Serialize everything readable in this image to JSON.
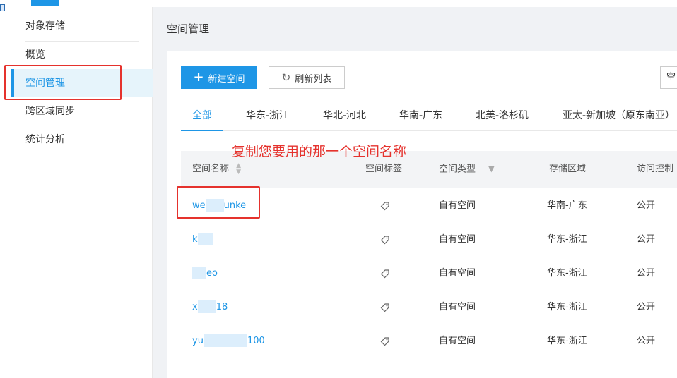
{
  "sidebar": {
    "section_title": "对象存储",
    "items": [
      {
        "label": "概览"
      },
      {
        "label": "空间管理"
      },
      {
        "label": "跨区域同步"
      },
      {
        "label": "统计分析"
      }
    ]
  },
  "main": {
    "title": "空间管理",
    "toolbar": {
      "new_bucket_label": "新建空间",
      "refresh_label": "刷新列表",
      "cut_off_button_label": "空"
    },
    "tabs": [
      {
        "label": "全部"
      },
      {
        "label": "华东-浙江"
      },
      {
        "label": "华北-河北"
      },
      {
        "label": "华南-广东"
      },
      {
        "label": "北美-洛杉矶"
      },
      {
        "label": "亚太-新加坡（原东南亚）"
      }
    ],
    "annotation": "复制您要用的那一个空间名称",
    "table": {
      "columns": [
        "空间名称",
        "空间标签",
        "空间类型",
        "存储区域",
        "访问控制"
      ],
      "rows": [
        {
          "name_start": "we",
          "name_end": "unke",
          "type": "自有空间",
          "region": "华南-广东",
          "access": "公开"
        },
        {
          "name_start": "k",
          "name_end": "",
          "type": "自有空间",
          "region": "华东-浙江",
          "access": "公开"
        },
        {
          "name_start": "",
          "name_end": "eo",
          "type": "自有空间",
          "region": "华东-浙江",
          "access": "公开"
        },
        {
          "name_start": "x",
          "name_end": "18",
          "type": "自有空间",
          "region": "华东-浙江",
          "access": "公开"
        },
        {
          "name_start": "yu",
          "name_end": "100",
          "type": "自有空间",
          "region": "华东-浙江",
          "access": "公开"
        }
      ]
    }
  },
  "colors": {
    "accent": "#1e96e6",
    "annotation_red": "#e5322d",
    "active_item_bg": "#e6f4fb"
  }
}
